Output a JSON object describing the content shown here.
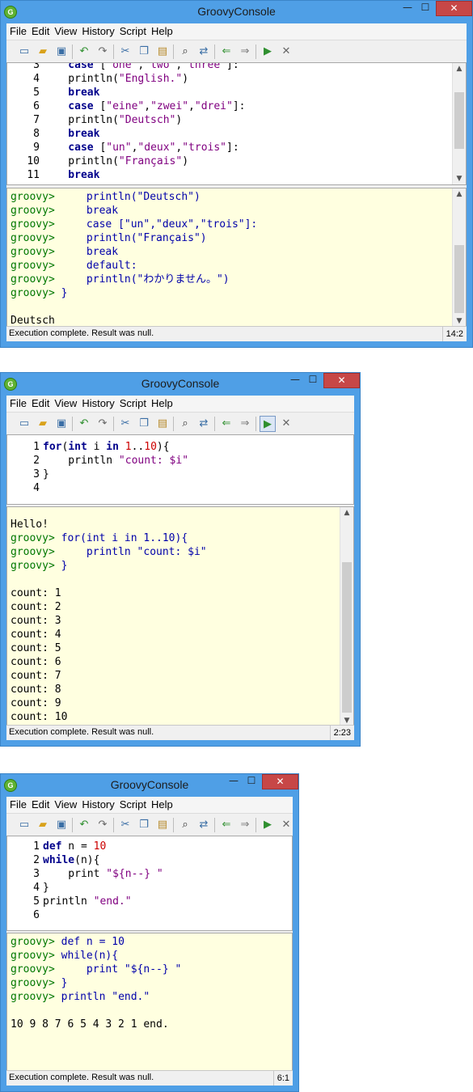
{
  "windows": [
    {
      "title": "GroovyConsole",
      "menu": [
        "File",
        "Edit",
        "View",
        "History",
        "Script",
        "Help"
      ],
      "code_lines": [
        {
          "n": "3",
          "parts": [
            [
              "kw",
              "    case "
            ],
            [
              "",
              "["
            ],
            [
              "str",
              "\"one\""
            ],
            [
              "",
              ","
            ],
            [
              "str",
              "\"two\""
            ],
            [
              "",
              ","
            ],
            [
              "str",
              "\"three\""
            ],
            [
              "",
              "]:"
            ]
          ]
        },
        {
          "n": "4",
          "parts": [
            [
              "",
              "    println("
            ],
            [
              "str",
              "\"English.\""
            ],
            [
              "",
              ")"
            ]
          ]
        },
        {
          "n": "5",
          "parts": [
            [
              "kw",
              "    break"
            ]
          ]
        },
        {
          "n": "6",
          "parts": [
            [
              "kw",
              "    case "
            ],
            [
              "",
              "["
            ],
            [
              "str",
              "\"eine\""
            ],
            [
              "",
              ","
            ],
            [
              "str",
              "\"zwei\""
            ],
            [
              "",
              ","
            ],
            [
              "str",
              "\"drei\""
            ],
            [
              "",
              "]:"
            ]
          ]
        },
        {
          "n": "7",
          "parts": [
            [
              "",
              "    println("
            ],
            [
              "str",
              "\"Deutsch\""
            ],
            [
              "",
              ")"
            ]
          ]
        },
        {
          "n": "8",
          "parts": [
            [
              "kw",
              "    break"
            ]
          ]
        },
        {
          "n": "9",
          "parts": [
            [
              "kw",
              "    case "
            ],
            [
              "",
              "["
            ],
            [
              "str",
              "\"un\""
            ],
            [
              "",
              ","
            ],
            [
              "str",
              "\"deux\""
            ],
            [
              "",
              ","
            ],
            [
              "str",
              "\"trois\""
            ],
            [
              "",
              "]:"
            ]
          ]
        },
        {
          "n": "10",
          "parts": [
            [
              "",
              "    println("
            ],
            [
              "str",
              "\"Français\""
            ],
            [
              "",
              ")"
            ]
          ]
        },
        {
          "n": "11",
          "parts": [
            [
              "kw",
              "    break"
            ]
          ]
        }
      ],
      "output_lines": [
        {
          "t": "cmd",
          "p": "groovy> ",
          "c": "    println(\"Deutsch\")"
        },
        {
          "t": "cmd",
          "p": "groovy> ",
          "c": "    break"
        },
        {
          "t": "cmd",
          "p": "groovy> ",
          "c": "    case [\"un\",\"deux\",\"trois\"]:"
        },
        {
          "t": "cmd",
          "p": "groovy> ",
          "c": "    println(\"Français\")"
        },
        {
          "t": "cmd",
          "p": "groovy> ",
          "c": "    break"
        },
        {
          "t": "cmd",
          "p": "groovy> ",
          "c": "    default:"
        },
        {
          "t": "cmd",
          "p": "groovy> ",
          "c": "    println(\"わかりません。\")"
        },
        {
          "t": "cmd",
          "p": "groovy> ",
          "c": "}"
        },
        {
          "t": "res",
          "p": "",
          "c": ""
        },
        {
          "t": "res",
          "p": "",
          "c": "Deutsch"
        }
      ],
      "status": "Execution complete. Result was null.",
      "position": "14:2"
    },
    {
      "title": "GroovyConsole",
      "menu": [
        "File",
        "Edit",
        "View",
        "History",
        "Script",
        "Help"
      ],
      "code_lines": [
        {
          "n": "1",
          "parts": [
            [
              "kw",
              "for"
            ],
            [
              "",
              "("
            ],
            [
              "kw",
              "int"
            ],
            [
              "",
              " i "
            ],
            [
              "kw",
              "in"
            ],
            [
              "",
              " "
            ],
            [
              "num",
              "1"
            ],
            [
              "",
              ".."
            ],
            [
              "num",
              "10"
            ],
            [
              "",
              "){"
            ]
          ]
        },
        {
          "n": "2",
          "parts": [
            [
              "",
              "    println "
            ],
            [
              "str",
              "\"count: $i\""
            ]
          ]
        },
        {
          "n": "3",
          "parts": [
            [
              "",
              "}"
            ]
          ]
        },
        {
          "n": "4",
          "parts": [
            [
              "",
              ""
            ]
          ]
        }
      ],
      "output_lines": [
        {
          "t": "res",
          "p": "",
          "c": "Hello!"
        },
        {
          "t": "cmd",
          "p": "groovy> ",
          "c": "for(int i in 1..10){"
        },
        {
          "t": "cmd",
          "p": "groovy> ",
          "c": "    println \"count: $i\""
        },
        {
          "t": "cmd",
          "p": "groovy> ",
          "c": "}"
        },
        {
          "t": "res",
          "p": "",
          "c": ""
        },
        {
          "t": "res",
          "p": "",
          "c": "count: 1"
        },
        {
          "t": "res",
          "p": "",
          "c": "count: 2"
        },
        {
          "t": "res",
          "p": "",
          "c": "count: 3"
        },
        {
          "t": "res",
          "p": "",
          "c": "count: 4"
        },
        {
          "t": "res",
          "p": "",
          "c": "count: 5"
        },
        {
          "t": "res",
          "p": "",
          "c": "count: 6"
        },
        {
          "t": "res",
          "p": "",
          "c": "count: 7"
        },
        {
          "t": "res",
          "p": "",
          "c": "count: 8"
        },
        {
          "t": "res",
          "p": "",
          "c": "count: 9"
        },
        {
          "t": "res",
          "p": "",
          "c": "count: 10"
        }
      ],
      "status": "Execution complete. Result was null.",
      "position": "2:23"
    },
    {
      "title": "GroovyConsole",
      "menu": [
        "File",
        "Edit",
        "View",
        "History",
        "Script",
        "Help"
      ],
      "code_lines": [
        {
          "n": "1",
          "parts": [
            [
              "kw",
              "def"
            ],
            [
              "",
              " n = "
            ],
            [
              "num",
              "10"
            ]
          ]
        },
        {
          "n": "2",
          "parts": [
            [
              "kw",
              "while"
            ],
            [
              "",
              "(n){"
            ]
          ]
        },
        {
          "n": "3",
          "parts": [
            [
              "",
              "    print "
            ],
            [
              "str",
              "\"${n--} \""
            ]
          ]
        },
        {
          "n": "4",
          "parts": [
            [
              "",
              "}"
            ]
          ]
        },
        {
          "n": "5",
          "parts": [
            [
              "",
              "println "
            ],
            [
              "str",
              "\"end.\""
            ]
          ]
        },
        {
          "n": "6",
          "parts": [
            [
              "",
              ""
            ]
          ]
        }
      ],
      "output_lines": [
        {
          "t": "cmd",
          "p": "groovy> ",
          "c": "def n = 10"
        },
        {
          "t": "cmd",
          "p": "groovy> ",
          "c": "while(n){"
        },
        {
          "t": "cmd",
          "p": "groovy> ",
          "c": "    print \"${n--} \""
        },
        {
          "t": "cmd",
          "p": "groovy> ",
          "c": "}"
        },
        {
          "t": "cmd",
          "p": "groovy> ",
          "c": "println \"end.\""
        },
        {
          "t": "res",
          "p": "",
          "c": ""
        },
        {
          "t": "res",
          "p": "",
          "c": "10 9 8 7 6 5 4 3 2 1 end."
        }
      ],
      "status": "Execution complete. Result was null.",
      "position": "6:1"
    }
  ],
  "app_icon_letter": "G",
  "window_buttons": {
    "minimize": "—",
    "maximize": "☐",
    "close": "✕"
  },
  "colors": {
    "titlebar": "#4f9fe6",
    "output_bg": "#ffffe0",
    "prompt": "#007700",
    "keyword": "#00008b",
    "string": "#800080",
    "number": "#cc0000",
    "close_button": "#c74747"
  }
}
